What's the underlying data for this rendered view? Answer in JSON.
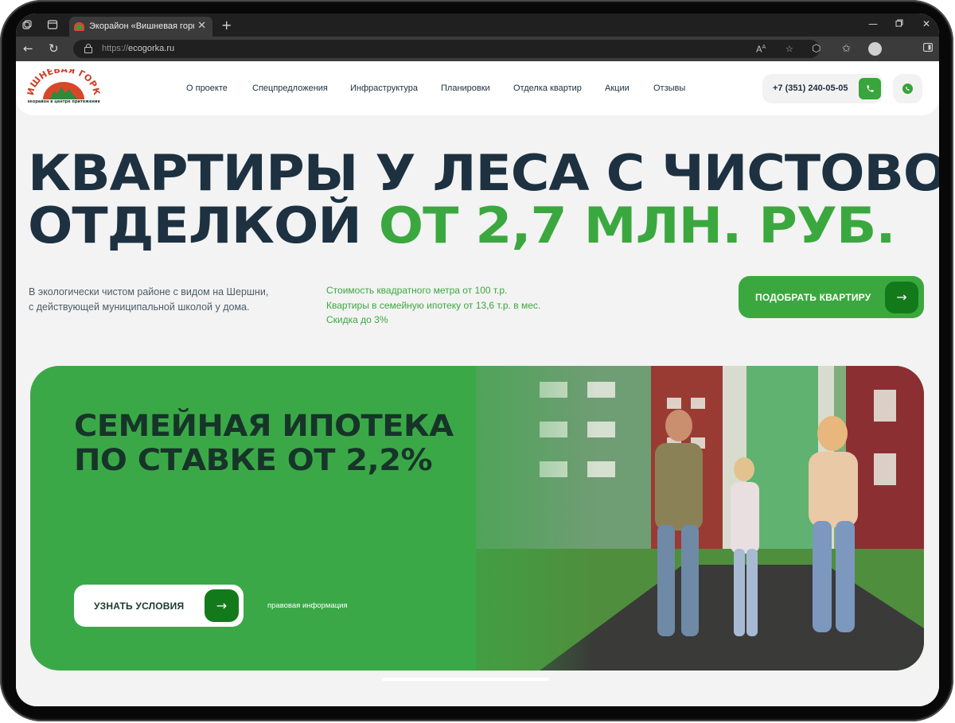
{
  "browser": {
    "tab_title": "Экорайон «Вишневая горка»: кв",
    "url_scheme": "https://",
    "url_host": "ecogorka.ru"
  },
  "logo": {
    "name": "ВИШНЁВАЯ ГОРКА",
    "tagline": "экорайон в центре притяжения"
  },
  "nav": [
    "О проекте",
    "Спецпредложения",
    "Инфраструктура",
    "Планировки",
    "Отделка квартир",
    "Акции",
    "Отзывы"
  ],
  "header": {
    "phone": "+7 (351) 240-05-05"
  },
  "hero": {
    "line1": "КВАРТИРЫ У ЛЕСА С ЧИСТОВОЙ",
    "line2_dark": "ОТДЕЛКОЙ",
    "line2_green": "ОТ 2,7 МЛН. РУБ."
  },
  "description": [
    "В экологически чистом районе с видом на Шершни,",
    "с действующей муниципальной школой у дома."
  ],
  "features": [
    "Стоимость квадратного метра от 100 т.р.",
    "Квартиры в семейную ипотеку от 13,6 т.р. в мес.",
    "Скидка до 3%"
  ],
  "cta": {
    "pick_label": "ПОДОБРАТЬ КВАРТИРУ"
  },
  "promo": {
    "title_line1": "СЕМЕЙНАЯ ИПОТЕКА",
    "title_line2": "ПО СТАВКЕ ОТ 2,2%",
    "button_label": "УЗНАТЬ УСЛОВИЯ",
    "legal_link": "правовая информация"
  },
  "colors": {
    "brand_green": "#3ba83f",
    "dark_green": "#137a1b",
    "heading_dark": "#1d3141"
  },
  "icons": {
    "call": "phone-icon",
    "whatsapp": "whatsapp-icon",
    "arrow": "arrow-right-icon"
  }
}
